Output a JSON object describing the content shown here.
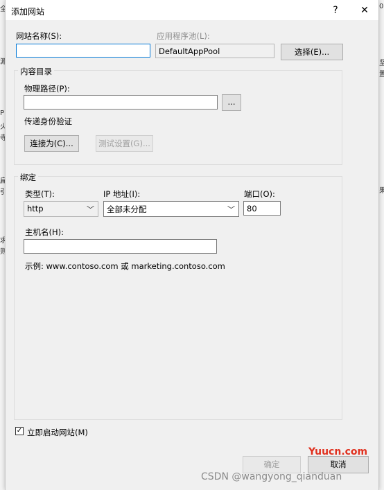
{
  "dialog": {
    "title": "添加网站",
    "help_label": "?",
    "close_label": "✕"
  },
  "site_name": {
    "label": "网站名称(S):",
    "value": ""
  },
  "app_pool": {
    "label": "应用程序池(L):",
    "value": "DefaultAppPool",
    "select_button": "选择(E)..."
  },
  "content_directory": {
    "group_title": "内容目录",
    "physical_path_label": "物理路径(P):",
    "physical_path_value": "",
    "browse_button": "...",
    "pass_through_label": "传递身份验证",
    "connect_as_button": "连接为(C)...",
    "test_settings_button": "测试设置(G)..."
  },
  "binding": {
    "group_title": "绑定",
    "type_label": "类型(T):",
    "type_value": "http",
    "ip_label": "IP 地址(I):",
    "ip_value": "全部未分配",
    "port_label": "端口(O):",
    "port_value": "80",
    "host_label": "主机名(H):",
    "host_value": "",
    "example_text": "示例: www.contoso.com 或 marketing.contoso.com"
  },
  "start_immediately": {
    "label": "立即启动网站(M)",
    "checked": true
  },
  "footer": {
    "ok_button": "确定",
    "cancel_button": "取消"
  },
  "overlay": {
    "site_mark": "Yuucn.com",
    "watermark": "CSDN @wangyong_qianduan"
  },
  "background_fragments": {
    "left": [
      "全",
      "源",
      "P",
      "火",
      "寺",
      "扁",
      "引",
      "求",
      "则"
    ],
    "right": [
      "0",
      "坚",
      "置",
      "果"
    ]
  }
}
